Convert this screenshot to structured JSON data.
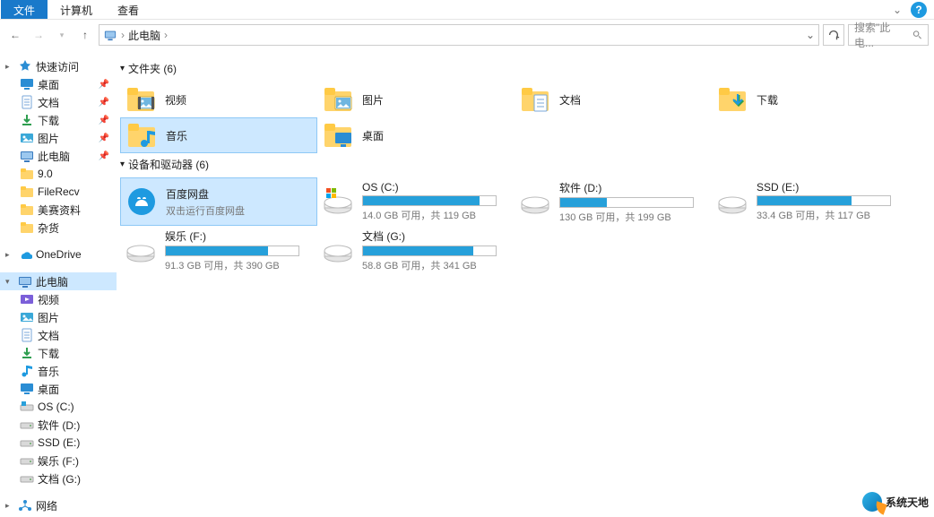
{
  "menubar": {
    "items": [
      "文件",
      "计算机",
      "查看"
    ]
  },
  "address": {
    "location": "此电脑"
  },
  "search": {
    "placeholder": "搜索\"此电..."
  },
  "tree": {
    "quick": {
      "label": "快速访问",
      "items": [
        {
          "label": "桌面",
          "pin": true,
          "icon": "desktop"
        },
        {
          "label": "文档",
          "pin": true,
          "icon": "doc"
        },
        {
          "label": "下载",
          "pin": true,
          "icon": "download"
        },
        {
          "label": "图片",
          "pin": true,
          "icon": "picture"
        },
        {
          "label": "此电脑",
          "pin": true,
          "icon": "pc"
        },
        {
          "label": "9.0",
          "pin": false,
          "icon": "folder"
        },
        {
          "label": "FileRecv",
          "pin": false,
          "icon": "folder"
        },
        {
          "label": "美赛资料",
          "pin": false,
          "icon": "folder"
        },
        {
          "label": "杂货",
          "pin": false,
          "icon": "folder"
        }
      ]
    },
    "onedrive": {
      "label": "OneDrive"
    },
    "thispc": {
      "label": "此电脑",
      "items": [
        {
          "label": "视频",
          "icon": "video"
        },
        {
          "label": "图片",
          "icon": "picture"
        },
        {
          "label": "文档",
          "icon": "doc"
        },
        {
          "label": "下载",
          "icon": "download"
        },
        {
          "label": "音乐",
          "icon": "music"
        },
        {
          "label": "桌面",
          "icon": "desktop"
        },
        {
          "label": "OS (C:)",
          "icon": "winvol"
        },
        {
          "label": "软件 (D:)",
          "icon": "drive"
        },
        {
          "label": "SSD (E:)",
          "icon": "drive"
        },
        {
          "label": "娱乐 (F:)",
          "icon": "drive"
        },
        {
          "label": "文档 (G:)",
          "icon": "drive"
        }
      ]
    },
    "network": {
      "label": "网络"
    }
  },
  "folders": {
    "header": "文件夹 (6)",
    "items": [
      {
        "label": "视频",
        "icon": "video"
      },
      {
        "label": "图片",
        "icon": "picture"
      },
      {
        "label": "文档",
        "icon": "doc"
      },
      {
        "label": "下载",
        "icon": "download"
      },
      {
        "label": "音乐",
        "icon": "music",
        "selected": true
      },
      {
        "label": "桌面",
        "icon": "desktop"
      }
    ]
  },
  "drives": {
    "header": "设备和驱动器 (6)",
    "items": [
      {
        "label": "百度网盘",
        "sub": "双击运行百度网盘",
        "icon": "baidu",
        "selected": true
      },
      {
        "label": "OS (C:)",
        "sub": "14.0 GB 可用，共 119 GB",
        "fill": 88,
        "icon": "winvol"
      },
      {
        "label": "软件 (D:)",
        "sub": "130 GB 可用，共 199 GB",
        "fill": 35,
        "icon": "drive"
      },
      {
        "label": "SSD (E:)",
        "sub": "33.4 GB 可用，共 117 GB",
        "fill": 71,
        "icon": "drive"
      },
      {
        "label": "娱乐 (F:)",
        "sub": "91.3 GB 可用，共 390 GB",
        "fill": 77,
        "icon": "drive"
      },
      {
        "label": "文档 (G:)",
        "sub": "58.8 GB 可用，共 341 GB",
        "fill": 83,
        "icon": "drive"
      }
    ]
  },
  "watermark": "系统天地"
}
